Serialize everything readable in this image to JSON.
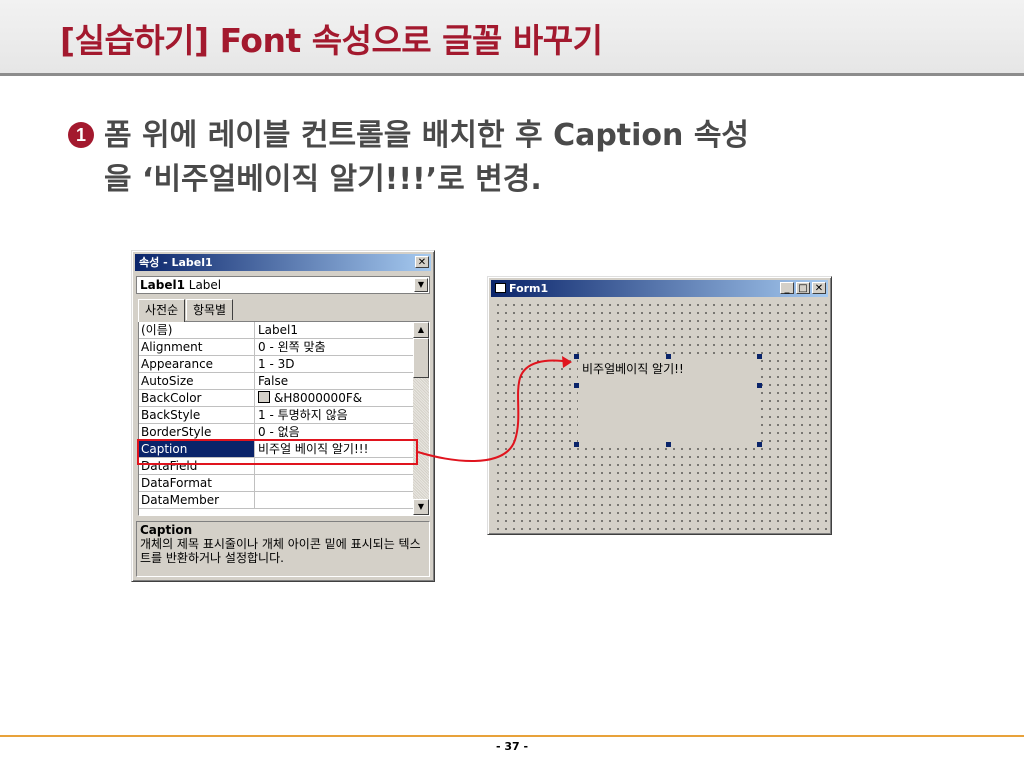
{
  "slide": {
    "title": "[실습하기] Font 속성으로 글꼴 바꾸기",
    "bullet_number": "1",
    "bullet_line1": "폼 위에 레이블 컨트롤을 배치한 후 Caption 속성",
    "bullet_line2": "을 ‘비주얼베이직 알기!!!’로 변경.",
    "page_number": "- 37 -"
  },
  "properties_window": {
    "title": "속성 - Label1",
    "object_bold": "Label1",
    "object_type": "Label",
    "tabs": [
      "사전순",
      "항목별"
    ],
    "rows": [
      {
        "name": "(이름)",
        "value": "Label1"
      },
      {
        "name": "Alignment",
        "value": "0 - 왼쪽 맞춤"
      },
      {
        "name": "Appearance",
        "value": "1 - 3D"
      },
      {
        "name": "AutoSize",
        "value": "False"
      },
      {
        "name": "BackColor",
        "value": "&H8000000F&"
      },
      {
        "name": "BackStyle",
        "value": "1 - 투명하지 않음"
      },
      {
        "name": "BorderStyle",
        "value": "0 - 없음"
      },
      {
        "name": "Caption",
        "value": "비주얼 베이직 알기!!!"
      },
      {
        "name": "DataField",
        "value": ""
      },
      {
        "name": "DataFormat",
        "value": ""
      },
      {
        "name": "DataMember",
        "value": ""
      }
    ],
    "selected_row": "Caption",
    "description_title": "Caption",
    "description_text": "개체의 제목 표시줄이나 개체 아이콘 밑에 표시되는 텍스트를 반환하거나 설정합니다."
  },
  "form_window": {
    "title": "Form1",
    "label_caption": "비주얼베이직 알기!!"
  },
  "colors": {
    "title": "#a3192e",
    "highlight": "#e0141e",
    "selection": "#0a246a"
  }
}
